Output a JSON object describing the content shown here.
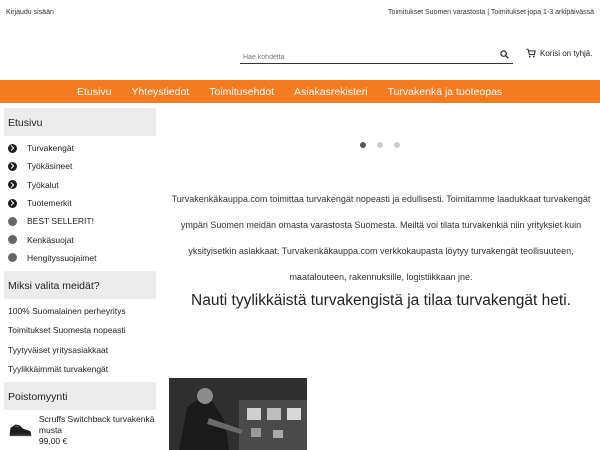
{
  "topbar": {
    "login": "Kirjaudu sisään",
    "shipping": "Toimitukset Suomen varastosta | Toimitukset jopa 1-3 arkipäivässä"
  },
  "search": {
    "placeholder": "Hae kohdetta",
    "icon": "search-icon"
  },
  "cart": {
    "label": "Korisi on tyhjä.",
    "icon": "cart-icon"
  },
  "nav": {
    "color": "#f47b20",
    "items": [
      {
        "label": "Etusivu"
      },
      {
        "label": "Yhteystiedot"
      },
      {
        "label": "Toimitusehdot"
      },
      {
        "label": "Asiakasrekisteri"
      },
      {
        "label": "Turvakenkä ja tuoteopas"
      }
    ]
  },
  "sidebar": {
    "menu_title": "Etusivu",
    "menu": [
      {
        "label": "Turvakengät",
        "icon": "chevron-right-icon"
      },
      {
        "label": "Työkäsineet",
        "icon": "chevron-right-icon"
      },
      {
        "label": "Työkalut",
        "icon": "chevron-right-icon"
      },
      {
        "label": "Tuotemerkit",
        "icon": "chevron-right-icon"
      },
      {
        "label": "BEST SELLERIT!",
        "icon": "circle-icon"
      },
      {
        "label": "Kenkäsuojat",
        "icon": "circle-icon"
      },
      {
        "label": "Hengityssuojaimet",
        "icon": "circle-icon"
      }
    ],
    "why_title": "Miksi valita meidät?",
    "why": [
      {
        "label": "100% Suomalainen perheyritys"
      },
      {
        "label": "Toimitukset Suomesta nopeasti"
      },
      {
        "label": "Tyytyväiset yritysasiakkaat"
      },
      {
        "label": "Tyylikkäimmät turvakengät"
      }
    ],
    "sale_title": "Poistomyynti",
    "sale_product": {
      "name": "Scruffs Switchback turvakenkä musta",
      "price": "99,00 €"
    }
  },
  "main": {
    "carousel_dots": 3,
    "carousel_active": 0,
    "intro": "Turvakenkäkauppa.com toimittaa turvakengät nopeasti ja edullisesti. Toimitamme laadukkaat turvakengät ympäri Suomen meidän omasta varastosta Suomesta. Meiltä voi tilata turvakenkiä niin yrityksiet kuin yksityisetkin asiakkaat. Turvakenkäkauppa.com verkkokaupasta löytyy turvakengät teollisuuteen, maatalouteen, rakennuksille, logistiikkaan jne.",
    "headline": "Nauti tyylikkäistä turvakengistä ja tilaa turvakengät heti."
  }
}
